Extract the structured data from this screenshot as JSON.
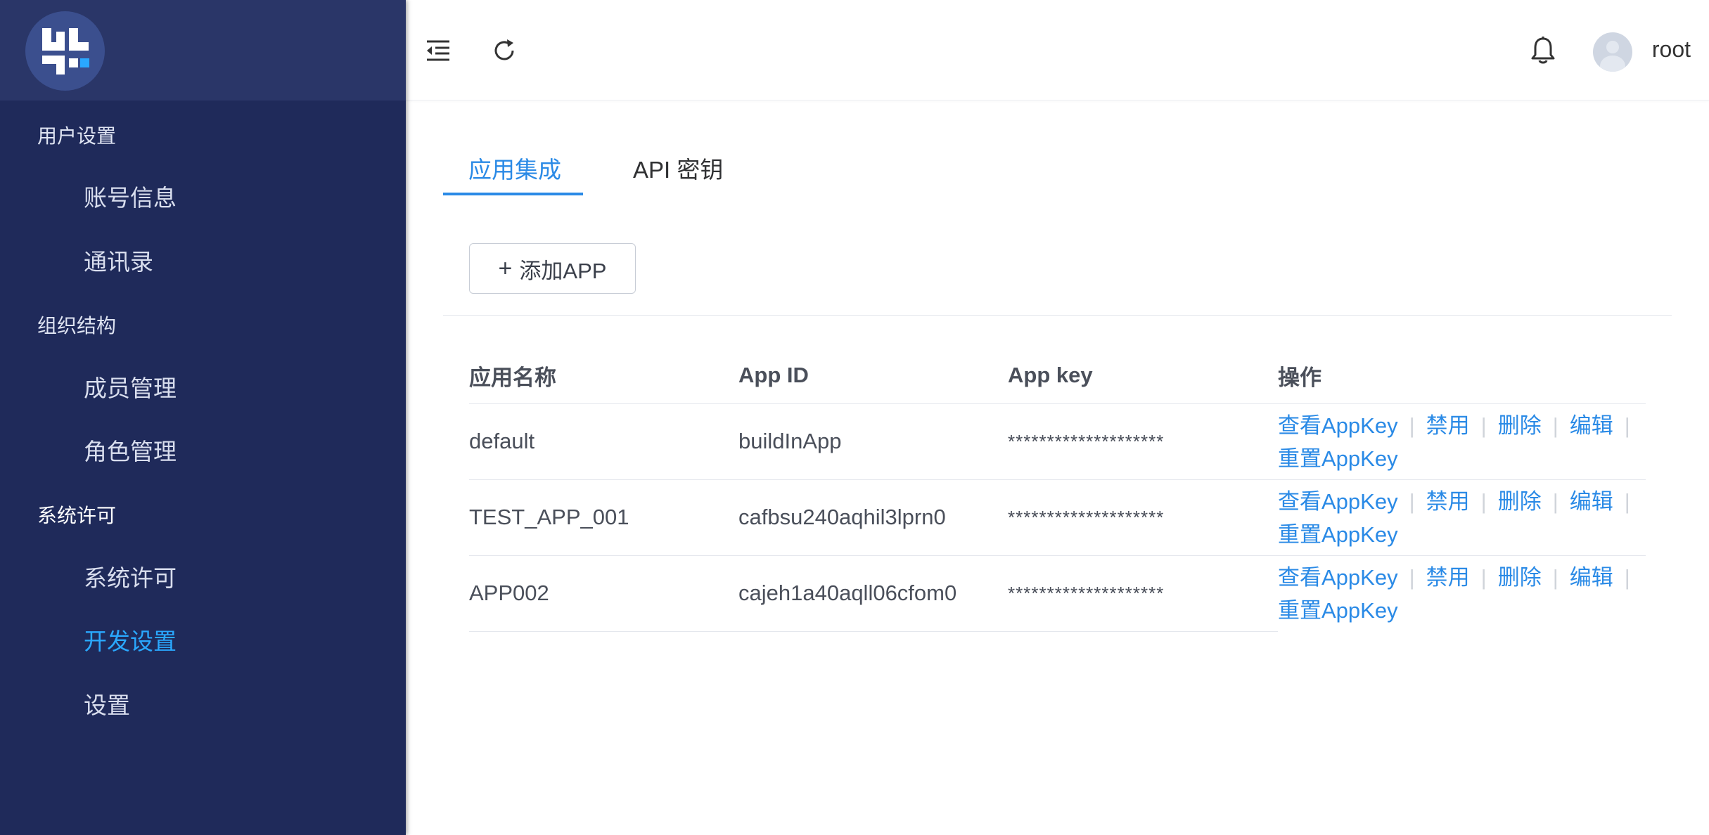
{
  "sidebar": {
    "groups": [
      {
        "title": "用户设置",
        "items": [
          {
            "label": "账号信息"
          },
          {
            "label": "通讯录"
          }
        ]
      },
      {
        "title": "组织结构",
        "items": [
          {
            "label": "成员管理"
          },
          {
            "label": "角色管理"
          }
        ]
      },
      {
        "title": "系统许可",
        "items": [
          {
            "label": "系统许可"
          },
          {
            "label": "开发设置"
          },
          {
            "label": "设置"
          }
        ]
      }
    ]
  },
  "header": {
    "username": "root",
    "icons": [
      "menu-collapse-icon",
      "refresh-icon",
      "bell-icon"
    ]
  },
  "main": {
    "tabs": [
      {
        "label": "应用集成"
      },
      {
        "label": "API 密钥"
      }
    ],
    "add_button_label": "添加APP",
    "table": {
      "headers": [
        "应用名称",
        "App ID",
        "App key",
        "操作"
      ],
      "rows": [
        {
          "name": "default",
          "app_id": "buildInApp",
          "app_key": "********************"
        },
        {
          "name": "TEST_APP_001",
          "app_id": "cafbsu240aqhil3lprn0",
          "app_key": "********************"
        },
        {
          "name": "APP002",
          "app_id": "cajeh1a40aqll06cfom0",
          "app_key": "********************"
        }
      ],
      "actions": {
        "view": "查看AppKey",
        "disable": "禁用",
        "delete": "删除",
        "edit": "编辑",
        "reset": "重置AppKey",
        "separator": "|"
      }
    }
  },
  "colors": {
    "sidebar_bg": "#1f2a5a",
    "sidebar_active": "#2aa8ff",
    "accent": "#2a8ae6"
  }
}
